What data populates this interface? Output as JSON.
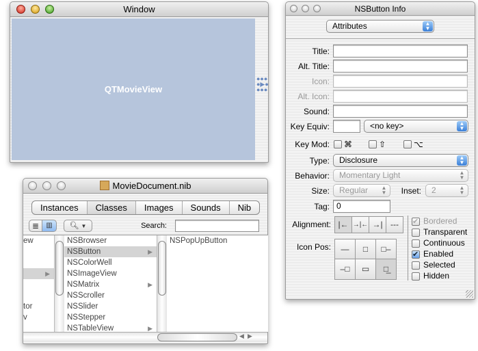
{
  "movie_window": {
    "title": "Window",
    "view_label": "QTMovieView",
    "view_color": "#b6c5dc"
  },
  "info_panel": {
    "title": "NSButton Info",
    "pane_select": "Attributes",
    "labels": {
      "title": "Title:",
      "alt_title": "Alt. Title:",
      "icon": "Icon:",
      "alt_icon": "Alt. Icon:",
      "sound": "Sound:",
      "key_equiv": "Key Equiv:",
      "key_mod": "Key Mod:",
      "type": "Type:",
      "behavior": "Behavior:",
      "size": "Size:",
      "inset": "Inset:",
      "tag": "Tag:",
      "alignment": "Alignment:",
      "icon_pos": "Icon Pos:"
    },
    "values": {
      "title": "",
      "alt_title": "",
      "icon": "",
      "alt_icon": "",
      "sound": "",
      "key_equiv": "",
      "key_select": "<no key>",
      "type": "Disclosure",
      "behavior": "Momentary Light",
      "size": "Regular",
      "inset": "2",
      "tag": "0"
    },
    "key_mods": [
      "⌘",
      "⇧",
      "⌥"
    ],
    "alignment": [
      "|←",
      "→|←",
      "→|",
      "---"
    ],
    "icon_positions": [
      "—",
      "□",
      "□–",
      "–□",
      "▭",
      "□̲"
    ],
    "checkboxes": [
      {
        "label": "Bordered",
        "checked": true,
        "disabled": true
      },
      {
        "label": "Transparent",
        "checked": false
      },
      {
        "label": "Continuous",
        "checked": false
      },
      {
        "label": "Enabled",
        "checked": true
      },
      {
        "label": "Selected",
        "checked": false
      },
      {
        "label": "Hidden",
        "checked": false
      }
    ]
  },
  "nib_window": {
    "title": "MovieDocument.nib",
    "tabs": [
      "Instances",
      "Classes",
      "Images",
      "Sounds",
      "Nib"
    ],
    "active_tab": "Classes",
    "search_label": "Search:",
    "search_value": "",
    "col1": [
      "ew",
      "",
      "",
      "",
      "",
      "",
      "tor",
      "v",
      ""
    ],
    "col2": [
      {
        "name": "NSBrowser"
      },
      {
        "name": "NSButton",
        "sub": true,
        "sel": true
      },
      {
        "name": "NSColorWell"
      },
      {
        "name": "NSImageView"
      },
      {
        "name": "NSMatrix",
        "sub": true
      },
      {
        "name": "NSScroller"
      },
      {
        "name": "NSSlider"
      },
      {
        "name": "NSStepper"
      },
      {
        "name": "NSTableView",
        "sub": true
      }
    ],
    "col3": [
      "NSPopUpButton"
    ]
  }
}
